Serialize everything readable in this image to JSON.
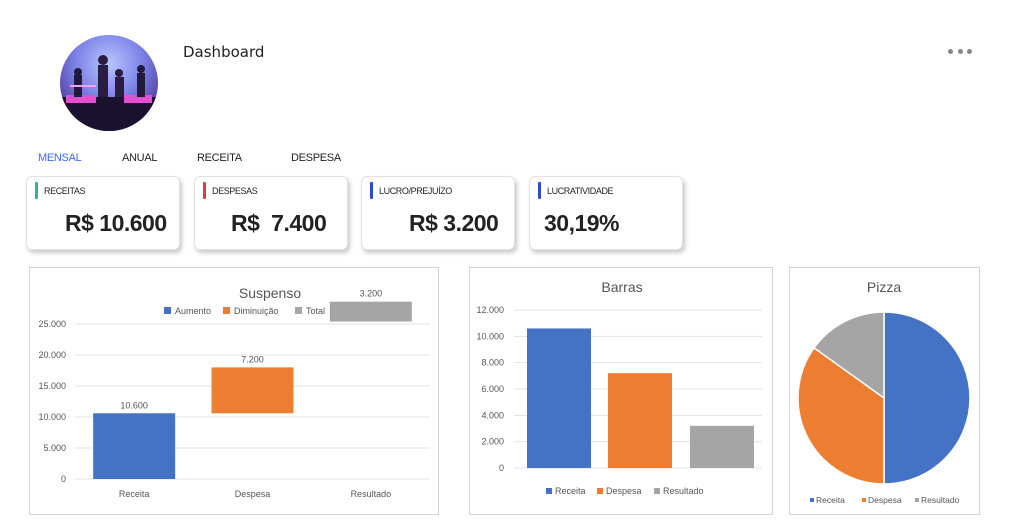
{
  "header": {
    "title": "Dashboard"
  },
  "tabs": [
    {
      "label": "MENSAL",
      "active": true
    },
    {
      "label": "ANUAL",
      "active": false
    },
    {
      "label": "RECEITA",
      "active": false
    },
    {
      "label": "DESPESA",
      "active": false
    }
  ],
  "kpis": [
    {
      "label": "RECEITAS",
      "value": "R$ 10.600",
      "color": "#2bb5a0"
    },
    {
      "label": "DESPESAS",
      "value": "R$  7.400",
      "color": "#e03c3c"
    },
    {
      "label": "LUCRO/PREJUÍZO",
      "value": "R$ 3.200",
      "color": "#3347d6"
    },
    {
      "label": "LUCRATIVIDADE",
      "value": "30,19%",
      "color": "#3347d6"
    }
  ],
  "colors": {
    "receita": "#4472c4",
    "despesa": "#ed7d31",
    "resultado": "#a5a5a5",
    "accent": "#3b6cf4"
  },
  "chart_data": [
    {
      "type": "bar",
      "subtype": "waterfall",
      "title": "Suspenso",
      "legend": [
        "Aumento",
        "Diminuição",
        "Total"
      ],
      "legend_position": "top",
      "categories": [
        "Receita",
        "Despesa",
        "Resultado"
      ],
      "values": [
        10600,
        -7400,
        3200
      ],
      "value_labels": [
        "10.600",
        "7.200",
        "3.200"
      ],
      "ylim": [
        0,
        25000
      ],
      "yticks": [
        "0",
        "5.000",
        "10.000",
        "15.000",
        "20.000",
        "25.000"
      ]
    },
    {
      "type": "bar",
      "title": "Barras",
      "categories": [
        "Receita",
        "Despesa",
        "Resultado"
      ],
      "values": [
        10600,
        7200,
        3200
      ],
      "legend": [
        "Receita",
        "Despesa",
        "Resultado"
      ],
      "legend_position": "bottom",
      "ylim": [
        0,
        12000
      ],
      "yticks": [
        "0",
        "2.000",
        "4.000",
        "6.000",
        "8.000",
        "10.000",
        "12.000"
      ]
    },
    {
      "type": "pie",
      "title": "Pizza",
      "categories": [
        "Receita",
        "Despesa",
        "Resultado"
      ],
      "values": [
        10600,
        7400,
        3200
      ],
      "legend": [
        "Receita",
        "Despesa",
        "Resultado"
      ],
      "legend_position": "bottom"
    }
  ]
}
